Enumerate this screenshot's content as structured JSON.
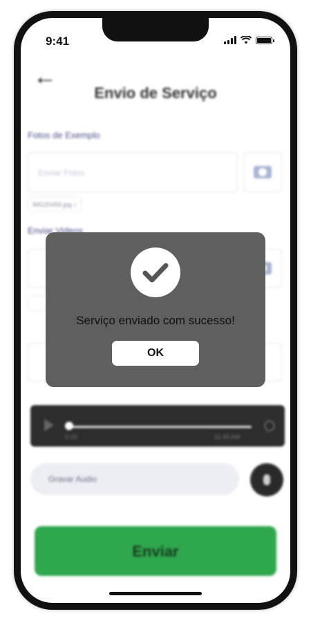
{
  "status_bar": {
    "time": "9:41"
  },
  "header": {
    "title": "Envio de Serviço"
  },
  "photos": {
    "label": "Fotos de Exemplo",
    "placeholder": "Enviar Fotos",
    "file_chip": "IMG20456.jpg"
  },
  "videos": {
    "label": "Enviar Videos"
  },
  "audio_player": {
    "current_time": "0:15",
    "duration": "11:45 AM",
    "progress": 0.0
  },
  "record": {
    "placeholder": "Gravar Audio"
  },
  "submit": {
    "label": "Enviar"
  },
  "dialog": {
    "message": "Serviço enviado com sucesso!",
    "ok_label": "OK"
  },
  "colors": {
    "primary_green": "#2fa84d",
    "dialog_bg": "#5f5f5f",
    "label_blue": "#4a4f8a"
  },
  "icons": [
    "back-arrow-icon",
    "camera-icon",
    "play-icon",
    "close-circle-icon",
    "microphone-icon",
    "check-icon"
  ]
}
